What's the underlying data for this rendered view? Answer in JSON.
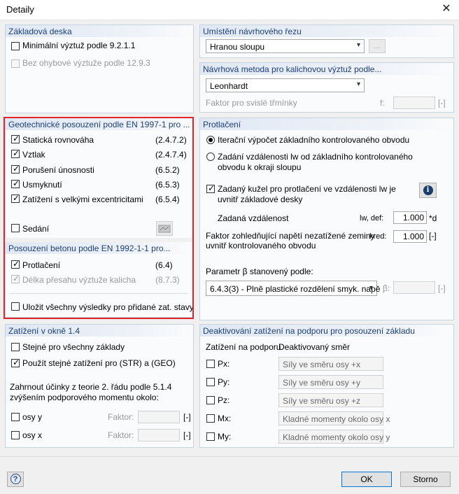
{
  "window": {
    "title": "Detaily",
    "close": "✕"
  },
  "zakladova": {
    "header": "Základová deska",
    "items": [
      {
        "label": "Minimální výztuž podle 9.2.1.1",
        "checked": false,
        "enabled": true
      },
      {
        "label": "Bez ohybové výztuže podle 12.9.3",
        "checked": false,
        "enabled": false
      }
    ]
  },
  "geo": {
    "header": "Geotechnické posouzení podle EN 1997-1 pro ...",
    "items": [
      {
        "label": "Statická rovnováha",
        "ref": "(2.4.7.2)",
        "checked": true
      },
      {
        "label": "Vztlak",
        "ref": "(2.4.7.4)",
        "checked": true
      },
      {
        "label": "Porušení únosnosti",
        "ref": "(6.5.2)",
        "checked": true
      },
      {
        "label": "Usmyknutí",
        "ref": "(6.5.3)",
        "checked": true
      },
      {
        "label": "Zatížení s velkými excentricitami",
        "ref": "(6.5.4)",
        "checked": true
      }
    ],
    "sedani": "Sedání"
  },
  "beton": {
    "header": "Posouzení betonu podle EN 1992-1-1 pro...",
    "protlaceni": "Protlačení",
    "protlaceni_ref": "(6.4)",
    "delka": "Délka přesahu výztuže kalicha",
    "delka_ref": "(8.7.3)",
    "ulozit": "Uložit všechny výsledky pro přidané zat. stavy"
  },
  "zatizeni": {
    "header": "Zatížení v okně 1.4",
    "stejne": "Stejné pro všechny základy",
    "pouzit": "Použít stejné zatížení pro (STR) a (GEO)",
    "zahrnout": "Zahrnout účinky z teorie 2. řádu podle 5.1.4 zvýšením podporového momentu okolo:",
    "osy_y": "osy y",
    "osy_x": "osy x",
    "faktor": "Faktor:",
    "unit": "[-]"
  },
  "umisteni": {
    "header": "Umístění návrhového řezu",
    "value": "Hranou sloupu",
    "dots": "..."
  },
  "metoda": {
    "header": "Návrhová metoda pro kalichovou výztuž podle...",
    "value": "Leonhardt",
    "faktor_label": "Faktor pro svislé třmínky",
    "f": "f:",
    "unit": "[-]"
  },
  "protlaceni": {
    "header": "Protlačení",
    "radio1": "Iterační výpočet základního kontrolovaného obvodu",
    "radio2a": "Zadání vzdálenosti lw od základního kontrolovaného",
    "radio2b": "obvodu k okraji sloupu",
    "kuzel_a": "Zadaný kužel pro protlačení ve vzdálenosti lw je",
    "kuzel_b": "uvnitř základové desky",
    "info": "i",
    "zadana": "Zadaná vzdálenost",
    "lw_sym": "lw, def:",
    "lw_val": "1.000",
    "lw_unit": "*d",
    "faktor_a": "Faktor zohledňující napětí nezatížené zeminy",
    "faktor_b": "uvnitř kontrolovaného obvodu",
    "kred_sym": "kred:",
    "kred_val": "1.000",
    "kred_unit": "[-]",
    "parametr": "Parametr β stanovený podle:",
    "beta_value": "6.4.3(3) - Plně plastické rozdělení smyk. napě",
    "beta_sym": "β:",
    "beta_unit": "[-]"
  },
  "deakt": {
    "header": "Deaktivování zatížení na podporu pro posouzení základu",
    "col1": "Zatížení na podporu",
    "col2": "Deaktivovaný směr",
    "rows": [
      {
        "sym": "Px:",
        "dir": "Síly ve směru osy +x"
      },
      {
        "sym": "Py:",
        "dir": "Síly ve směru osy +y"
      },
      {
        "sym": "Pz:",
        "dir": "Síly ve směru osy +z"
      },
      {
        "sym": "Mx:",
        "dir": "Kladné momenty okolo osy x"
      },
      {
        "sym": "My:",
        "dir": "Kladné momenty okolo osy y"
      }
    ]
  },
  "footer": {
    "ok": "OK",
    "storno": "Storno",
    "help": "?"
  },
  "icons": [
    "close-icon",
    "chevron-down-icon",
    "checkmark-icon",
    "info-icon",
    "help-icon",
    "settings-icon"
  ]
}
